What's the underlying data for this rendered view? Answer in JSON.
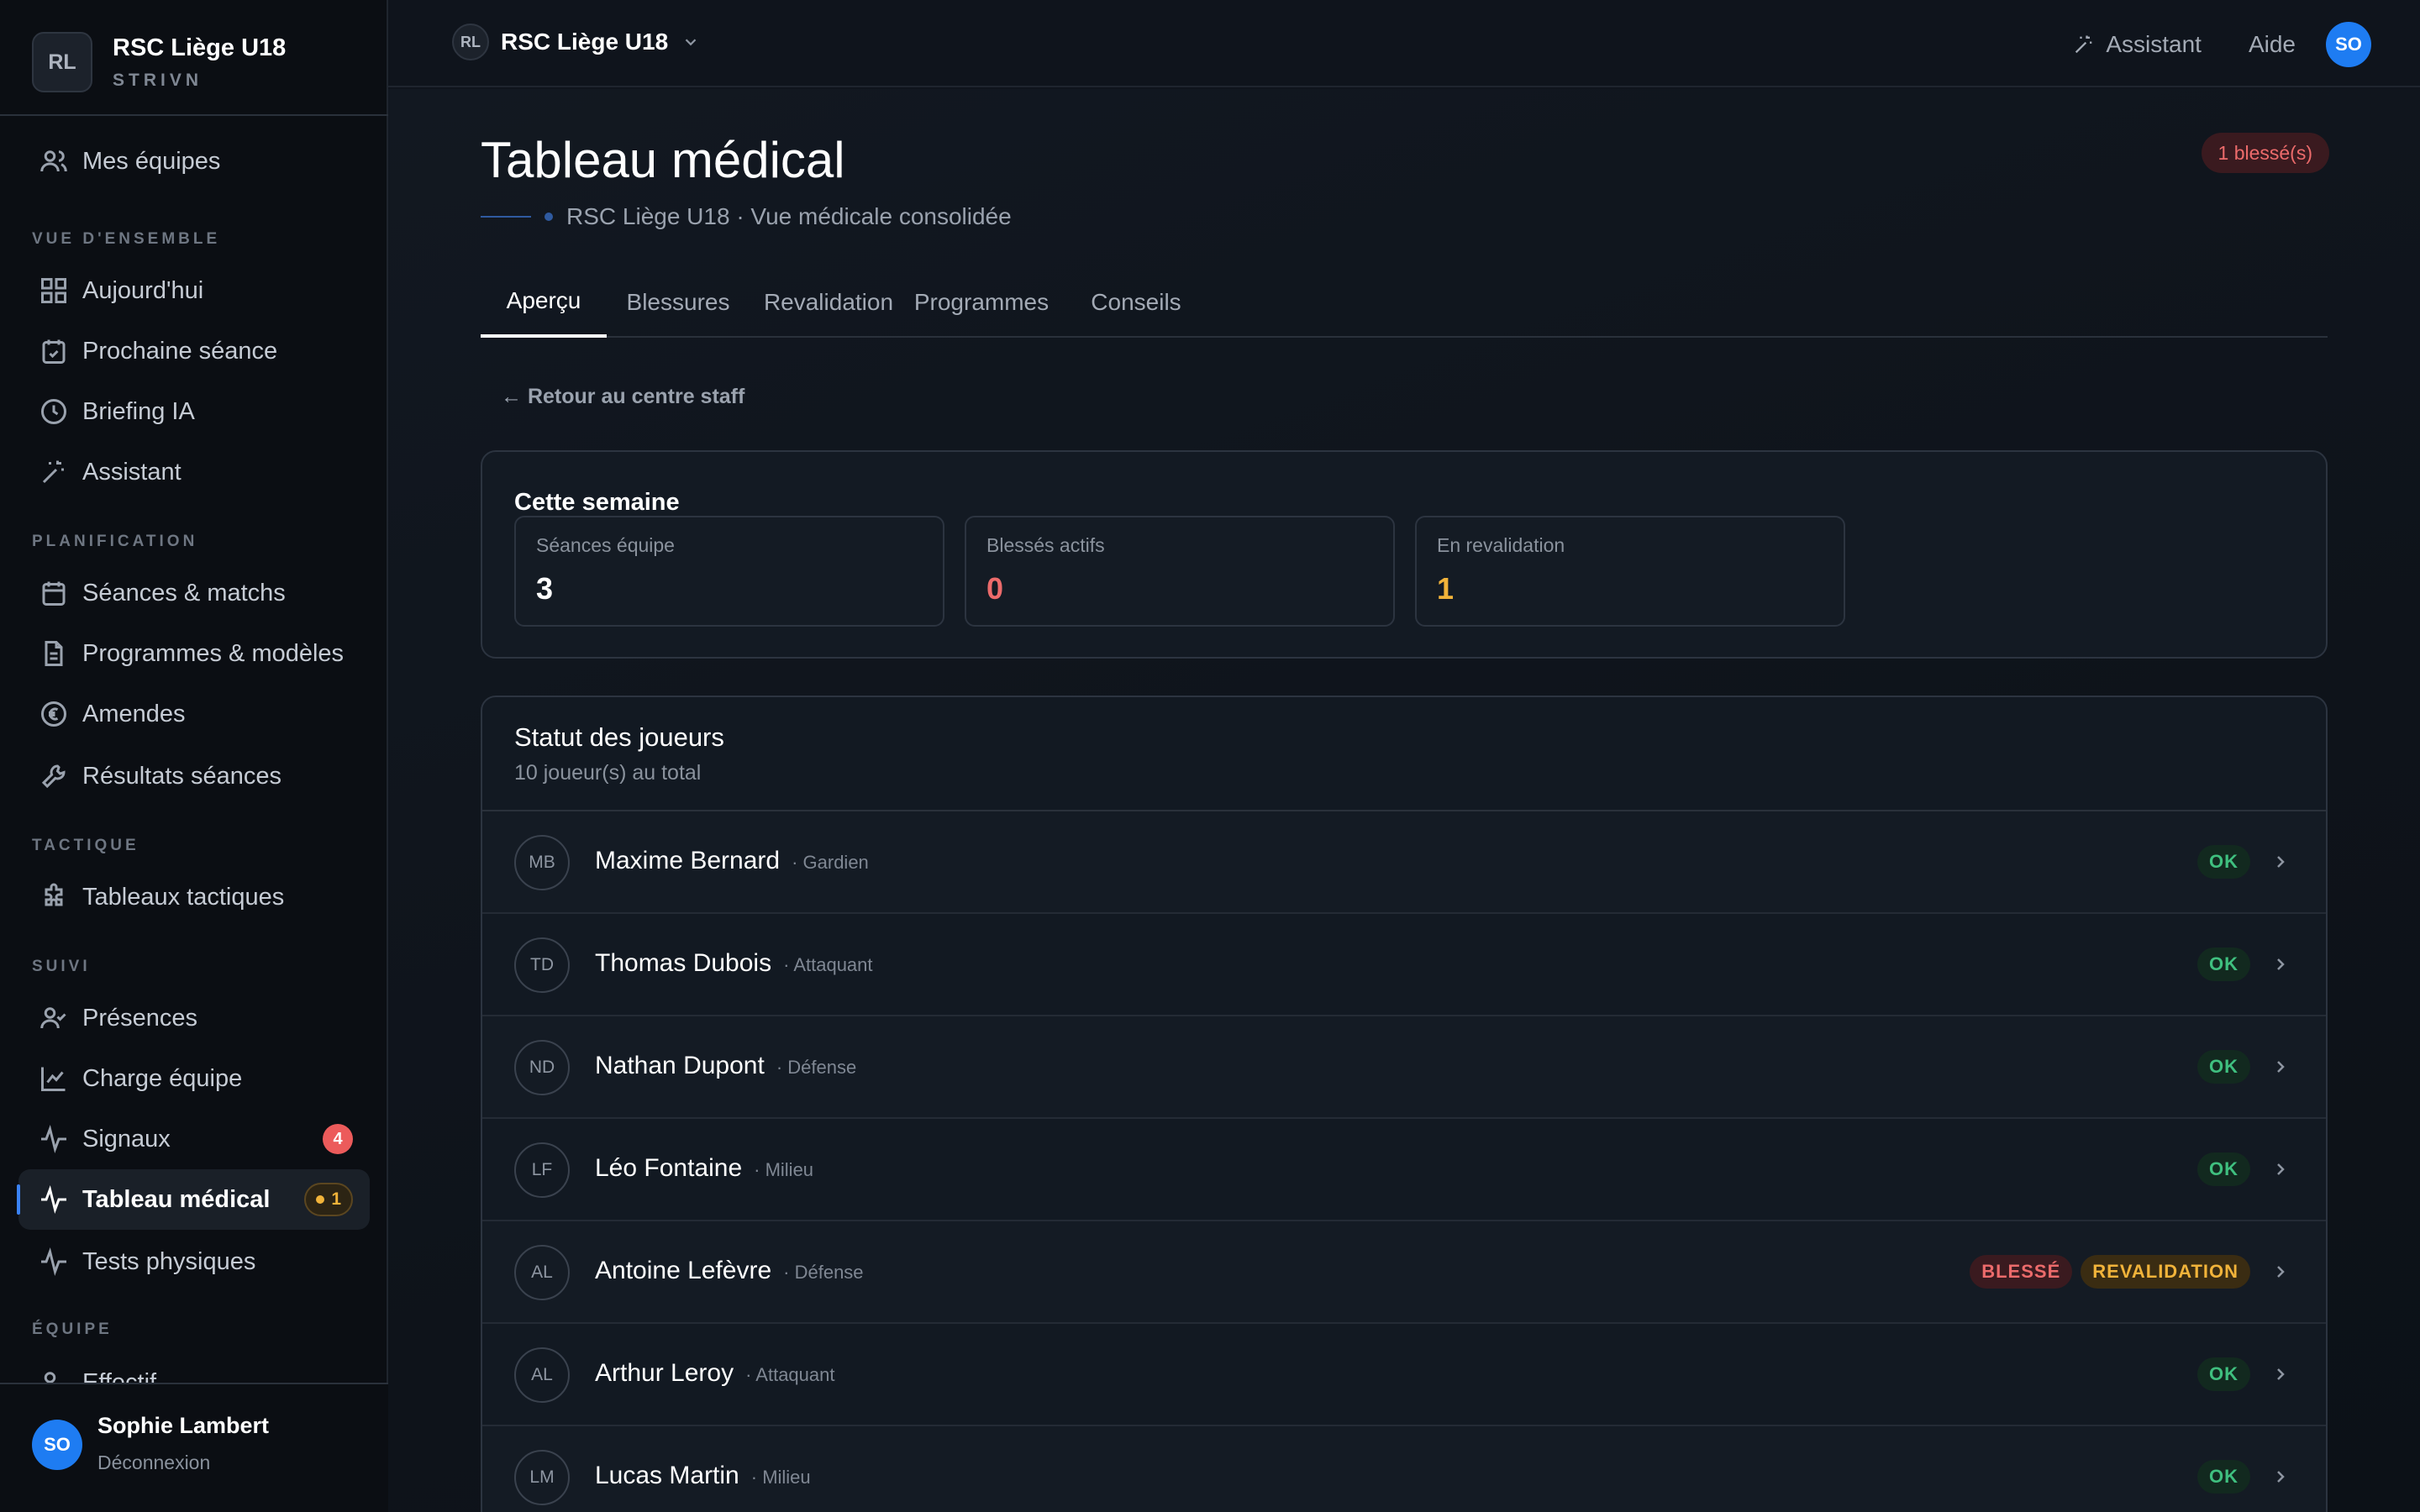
{
  "sidebar": {
    "brand": {
      "initials": "RL",
      "name": "RSC Liège U18",
      "sub": "STRIVN"
    },
    "top_item": {
      "label": "Mes équipes",
      "icon": "users-icon"
    },
    "sections": [
      {
        "title": "VUE D'ENSEMBLE",
        "items": [
          {
            "label": "Aujourd'hui",
            "icon": "grid-icon"
          },
          {
            "label": "Prochaine séance",
            "icon": "calendar-check-icon"
          },
          {
            "label": "Briefing IA",
            "icon": "clock-icon"
          },
          {
            "label": "Assistant",
            "icon": "sparkles-icon"
          }
        ]
      },
      {
        "title": "PLANIFICATION",
        "items": [
          {
            "label": "Séances & matchs",
            "icon": "calendar-icon"
          },
          {
            "label": "Programmes & modèles",
            "icon": "document-icon"
          },
          {
            "label": "Amendes",
            "icon": "euro-icon"
          },
          {
            "label": "Résultats séances",
            "icon": "wrench-icon"
          }
        ]
      },
      {
        "title": "TACTIQUE",
        "items": [
          {
            "label": "Tableaux tactiques",
            "icon": "puzzle-icon"
          }
        ]
      },
      {
        "title": "SUIVI",
        "items": [
          {
            "label": "Présences",
            "icon": "user-check-icon"
          },
          {
            "label": "Charge équipe",
            "icon": "chart-line-icon"
          },
          {
            "label": "Signaux",
            "icon": "pulse-icon",
            "badge": "4"
          },
          {
            "label": "Tableau médical",
            "icon": "pulse-icon",
            "badge": "1",
            "active": true
          },
          {
            "label": "Tests physiques",
            "icon": "pulse-icon"
          }
        ]
      },
      {
        "title": "ÉQUIPE",
        "items": [
          {
            "label": "Effectif",
            "icon": "users-icon"
          }
        ]
      }
    ],
    "user": {
      "initials": "SO",
      "name": "Sophie Lambert",
      "logout": "Déconnexion"
    }
  },
  "topbar": {
    "team_initials": "RL",
    "team_name": "RSC Liège U18",
    "assistant": "Assistant",
    "help": "Aide",
    "user_initials": "SO"
  },
  "page": {
    "title": "Tableau médical",
    "subtitle": "RSC Liège U18 · Vue médicale consolidée",
    "injured_pill": "1 blessé(s)",
    "tabs": [
      "Aperçu",
      "Blessures",
      "Revalidation",
      "Programmes",
      "Conseils"
    ],
    "active_tab": 0,
    "back_link": "← Retour au centre staff"
  },
  "week": {
    "title": "Cette semaine",
    "stats": [
      {
        "label": "Séances équipe",
        "value": "3",
        "color": "#ffffff"
      },
      {
        "label": "Blessés actifs",
        "value": "0",
        "color": "#ec6b6b"
      },
      {
        "label": "En revalidation",
        "value": "1",
        "color": "#f1b33a"
      }
    ]
  },
  "players": {
    "title": "Statut des joueurs",
    "subtitle": "10 joueur(s) au total",
    "rows": [
      {
        "initials": "MB",
        "name": "Maxime Bernard",
        "position": "· Gardien",
        "statuses": [
          {
            "text": "OK",
            "kind": "ok"
          }
        ]
      },
      {
        "initials": "TD",
        "name": "Thomas Dubois",
        "position": "· Attaquant",
        "statuses": [
          {
            "text": "OK",
            "kind": "ok"
          }
        ]
      },
      {
        "initials": "ND",
        "name": "Nathan Dupont",
        "position": "· Défense",
        "statuses": [
          {
            "text": "OK",
            "kind": "ok"
          }
        ]
      },
      {
        "initials": "LF",
        "name": "Léo Fontaine",
        "position": "· Milieu",
        "statuses": [
          {
            "text": "OK",
            "kind": "ok"
          }
        ]
      },
      {
        "initials": "AL",
        "name": "Antoine Lefèvre",
        "position": "· Défense",
        "statuses": [
          {
            "text": "BLESSÉ",
            "kind": "inj"
          },
          {
            "text": "REVALIDATION",
            "kind": "rev"
          }
        ]
      },
      {
        "initials": "AL",
        "name": "Arthur Leroy",
        "position": "· Attaquant",
        "statuses": [
          {
            "text": "OK",
            "kind": "ok"
          }
        ]
      },
      {
        "initials": "LM",
        "name": "Lucas Martin",
        "position": "· Milieu",
        "statuses": [
          {
            "text": "OK",
            "kind": "ok"
          }
        ]
      }
    ]
  }
}
